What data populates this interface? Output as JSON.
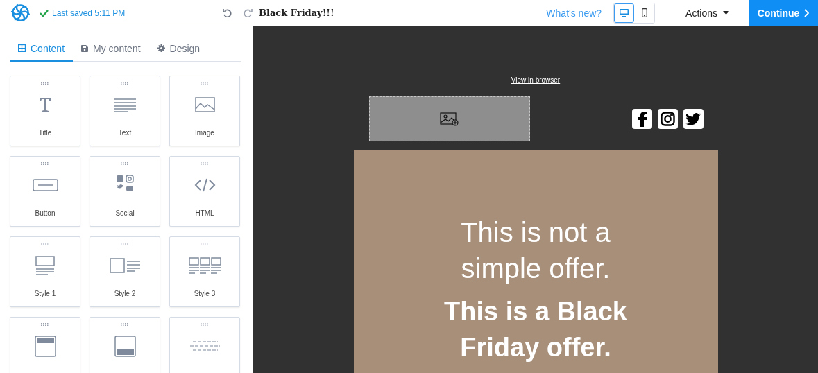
{
  "header": {
    "last_saved": "Last saved 5:11 PM",
    "title": "Black Friday!!!",
    "whats_new": "What's new?",
    "devices": [
      {
        "kind": "desktop",
        "selected": true
      },
      {
        "kind": "mobile",
        "selected": false
      }
    ],
    "actions": "Actions",
    "continue": "Continue"
  },
  "sidebar": {
    "tabs": [
      {
        "kind": "content",
        "label": "Content",
        "selected": true
      },
      {
        "kind": "saved",
        "label": "My content",
        "selected": false
      },
      {
        "kind": "design",
        "label": "Design",
        "selected": false
      }
    ],
    "blocks": [
      {
        "kind": "title",
        "label": "Title"
      },
      {
        "kind": "text",
        "label": "Text"
      },
      {
        "kind": "image",
        "label": "Image"
      },
      {
        "kind": "button",
        "label": "Button"
      },
      {
        "kind": "social",
        "label": "Social"
      },
      {
        "kind": "html",
        "label": "HTML"
      },
      {
        "kind": "style1",
        "label": "Style 1"
      },
      {
        "kind": "style2",
        "label": "Style 2"
      },
      {
        "kind": "style3",
        "label": "Style 3"
      },
      {
        "kind": "header"
      },
      {
        "kind": "footer"
      },
      {
        "kind": "divider"
      }
    ]
  },
  "email": {
    "view_in_browser": "View in browser",
    "social": [
      {
        "kind": "facebook"
      },
      {
        "kind": "instagram"
      },
      {
        "kind": "twitter"
      }
    ],
    "headline": "This is not a simple offer.",
    "subheadline": "This is a Black Friday offer."
  }
}
